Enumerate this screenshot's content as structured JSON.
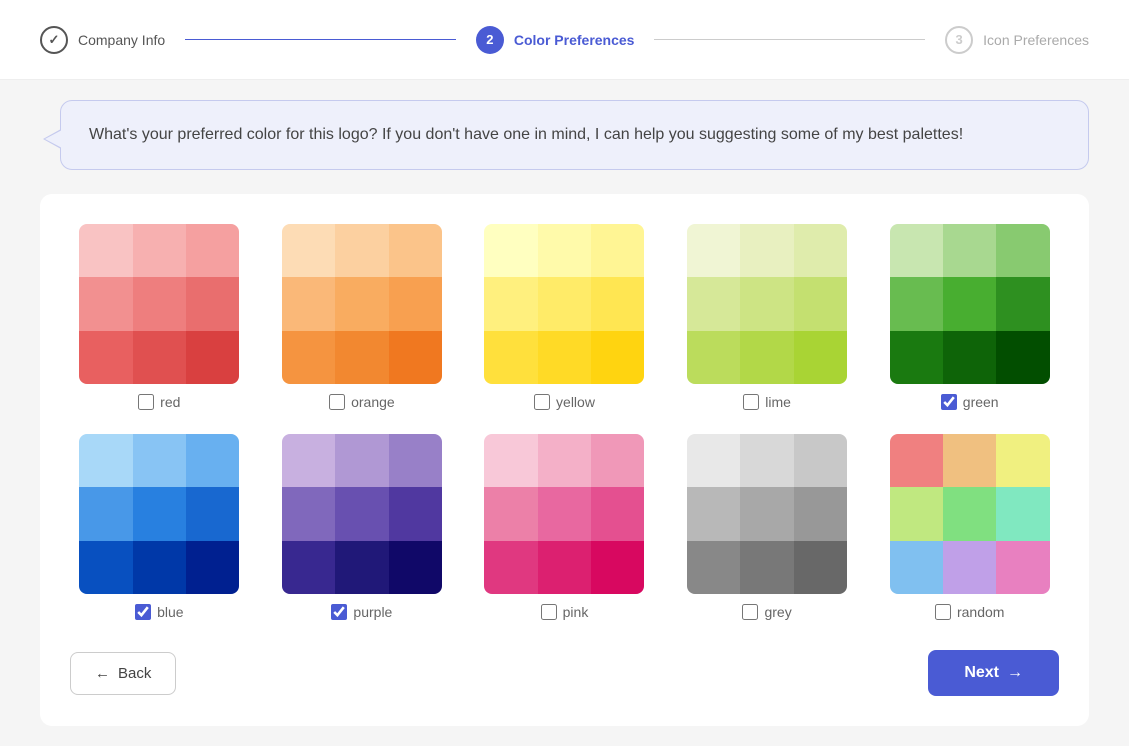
{
  "stepper": {
    "steps": [
      {
        "id": "company-info",
        "label": "Company Info",
        "state": "completed",
        "number": "✓"
      },
      {
        "id": "color-preferences",
        "label": "Color Preferences",
        "state": "active",
        "number": "2"
      },
      {
        "id": "icon-preferences",
        "label": "Icon Preferences",
        "state": "inactive",
        "number": "3"
      }
    ]
  },
  "chat": {
    "message": "What's your preferred color for this logo? If you don't have one in mind, I can help you suggesting some of my best palettes!"
  },
  "colors": [
    {
      "id": "red",
      "label": "red",
      "checked": false,
      "cells": [
        "#f9c3c3",
        "#f7b0b0",
        "#f5a0a0",
        "#f29090",
        "#ee7e7e",
        "#e96e6e",
        "#e86060",
        "#e05050",
        "#d94040"
      ]
    },
    {
      "id": "orange",
      "label": "orange",
      "checked": false,
      "cells": [
        "#fddcb5",
        "#fcd0a0",
        "#fbc48a",
        "#fab878",
        "#f9ac60",
        "#f8a050",
        "#f59440",
        "#f28830",
        "#f07820"
      ]
    },
    {
      "id": "yellow",
      "label": "yellow",
      "checked": false,
      "cells": [
        "#ffffc0",
        "#fffaaa",
        "#fff594",
        "#fff07e",
        "#ffeb68",
        "#ffe652",
        "#ffe03c",
        "#ffda26",
        "#ffd410"
      ]
    },
    {
      "id": "lime",
      "label": "lime",
      "checked": false,
      "cells": [
        "#f0f5d4",
        "#e8f0c0",
        "#dfecac",
        "#d6e898",
        "#cde484",
        "#c4e070",
        "#bbdc5c",
        "#b2d848",
        "#a9d434"
      ]
    },
    {
      "id": "green",
      "label": "green",
      "checked": true,
      "cells": [
        "#c8e6b0",
        "#a8d890",
        "#88ca70",
        "#68bc50",
        "#48ae30",
        "#2e9020",
        "#1a7a10",
        "#0e6408",
        "#024e00"
      ]
    },
    {
      "id": "blue",
      "label": "blue",
      "checked": true,
      "cells": [
        "#a8d8f8",
        "#88c4f4",
        "#68b0f0",
        "#4898e8",
        "#2880e0",
        "#1868d0",
        "#0850c0",
        "#0038a8",
        "#002090"
      ]
    },
    {
      "id": "purple",
      "label": "purple",
      "checked": true,
      "cells": [
        "#c8b0e0",
        "#b098d4",
        "#9880c8",
        "#8068bc",
        "#6850b0",
        "#5038a0",
        "#382890",
        "#201878",
        "#100868"
      ]
    },
    {
      "id": "pink",
      "label": "pink",
      "checked": false,
      "cells": [
        "#f8c8d8",
        "#f4b0c8",
        "#f098b8",
        "#ec80a8",
        "#e868a0",
        "#e45090",
        "#e03880",
        "#dc2070",
        "#d80860"
      ]
    },
    {
      "id": "grey",
      "label": "grey",
      "checked": false,
      "cells": [
        "#e8e8e8",
        "#d8d8d8",
        "#c8c8c8",
        "#b8b8b8",
        "#a8a8a8",
        "#989898",
        "#888888",
        "#787878",
        "#686868"
      ]
    },
    {
      "id": "random",
      "label": "random",
      "checked": false,
      "cells": [
        "#f08080",
        "#f0c080",
        "#f0f080",
        "#c0e880",
        "#80e080",
        "#80e8c0",
        "#80c0f0",
        "#c0a0e8",
        "#e880c0"
      ]
    }
  ],
  "buttons": {
    "back_label": "Back",
    "next_label": "Next",
    "back_arrow": "←",
    "next_arrow": "→"
  }
}
